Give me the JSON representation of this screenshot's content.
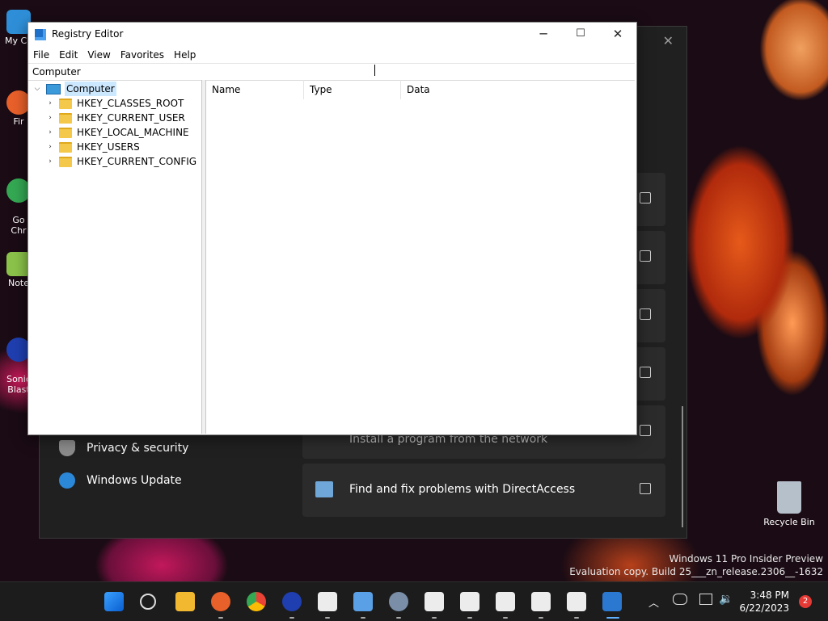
{
  "desktop": {
    "icons": [
      {
        "label": "My Co",
        "name": "desktop-icon-my-computer"
      },
      {
        "label": "Fir",
        "name": "desktop-icon-firefox"
      },
      {
        "label": "Go\nChr",
        "name": "desktop-icon-google-chrome"
      },
      {
        "label": "Note",
        "name": "desktop-icon-notepad"
      },
      {
        "label": "Sonic\nBlast",
        "name": "desktop-icon-sonic-blast"
      }
    ],
    "recycle_bin_label": "Recycle Bin",
    "watermark_line1": "Windows 11 Pro Insider Preview",
    "watermark_line2": "Evaluation copy. Build 25___zn_release.2306__-1632"
  },
  "settings": {
    "nav_items": [
      {
        "label": "Privacy & security",
        "icon": "shield-icon"
      },
      {
        "label": "Windows Update",
        "icon": "windows-update-icon"
      }
    ],
    "cards": [
      {
        "label": ""
      },
      {
        "label": ""
      },
      {
        "label": ""
      },
      {
        "label": ""
      },
      {
        "label": "Install a program from the network"
      },
      {
        "label": "Find and fix problems with DirectAccess"
      }
    ]
  },
  "regedit": {
    "title": "Registry Editor",
    "menu": [
      "File",
      "Edit",
      "View",
      "Favorites",
      "Help"
    ],
    "address": "Computer",
    "tree": {
      "root": "Computer",
      "children": [
        "HKEY_CLASSES_ROOT",
        "HKEY_CURRENT_USER",
        "HKEY_LOCAL_MACHINE",
        "HKEY_USERS",
        "HKEY_CURRENT_CONFIG"
      ]
    },
    "columns": [
      "Name",
      "Type",
      "Data"
    ]
  },
  "taskbar": {
    "apps": [
      "start-icon",
      "search-icon",
      "file-explorer-icon",
      "firefox-icon",
      "chrome-icon",
      "sonic-icon",
      "app-icon",
      "notepad-icon",
      "settings-icon",
      "app-icon",
      "app-icon",
      "app-icon",
      "app-icon",
      "app-icon",
      "registry-editor-icon"
    ],
    "time": "3:48 PM",
    "date": "6/22/2023",
    "notifications": "2"
  },
  "colors": {
    "taskbar_bg": "#1c1c1c",
    "settings_bg": "#202020",
    "selection": "#cce8ff",
    "folder": "#f4c84a"
  }
}
